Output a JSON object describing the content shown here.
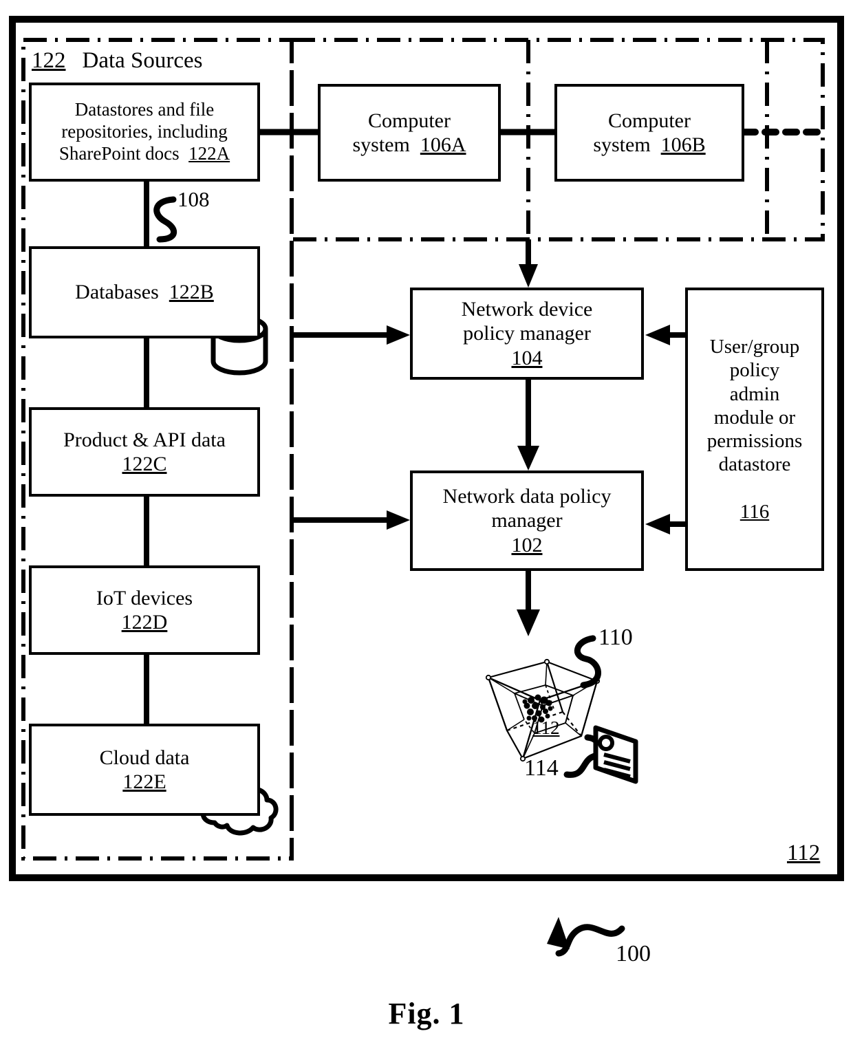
{
  "figure": {
    "caption": "Fig. 1",
    "system_ref": "100",
    "system_container_ref": "112"
  },
  "regions": {
    "data_sources": {
      "ref": "122",
      "label": "Data Sources"
    },
    "network": {
      "label": ""
    }
  },
  "nodes": {
    "datastores": {
      "line1": "Datastores and file",
      "line2": "repositories, including",
      "line3": "SharePoint docs",
      "ref": "122A"
    },
    "databases": {
      "label": "Databases",
      "ref": "122B",
      "icon": "database-cylinder-icon"
    },
    "product_api": {
      "label": "Product & API data",
      "ref": "122C"
    },
    "iot": {
      "label": "IoT devices",
      "ref": "122D"
    },
    "cloud": {
      "label": "Cloud data",
      "ref": "122E",
      "icon": "cloud-icon"
    },
    "computer_a": {
      "line1": "Computer",
      "line2": "system",
      "ref": "106A"
    },
    "computer_b": {
      "line1": "Computer",
      "line2": "system",
      "ref": "106B"
    },
    "device_policy_manager": {
      "line1": "Network device",
      "line2": "policy manager",
      "ref": "104"
    },
    "data_policy_manager": {
      "line1": "Network data policy",
      "line2": "manager",
      "ref": "102"
    },
    "user_group_admin": {
      "line1": "User/group",
      "line2": "policy",
      "line3": "admin",
      "line4": "module or",
      "line5": "permissions",
      "line6": "datastore",
      "ref": "116"
    }
  },
  "annotations": {
    "network_link": "108",
    "cube_callout": "110",
    "cube_ref": "112",
    "badge_callout": "114"
  },
  "icons": {
    "hypercube": "hypercube-visualization-icon",
    "badge": "id-badge-icon",
    "cloud": "cloud-icon",
    "cylinder": "database-cylinder-icon"
  },
  "colors": {
    "stroke": "#000000",
    "background": "#ffffff"
  }
}
